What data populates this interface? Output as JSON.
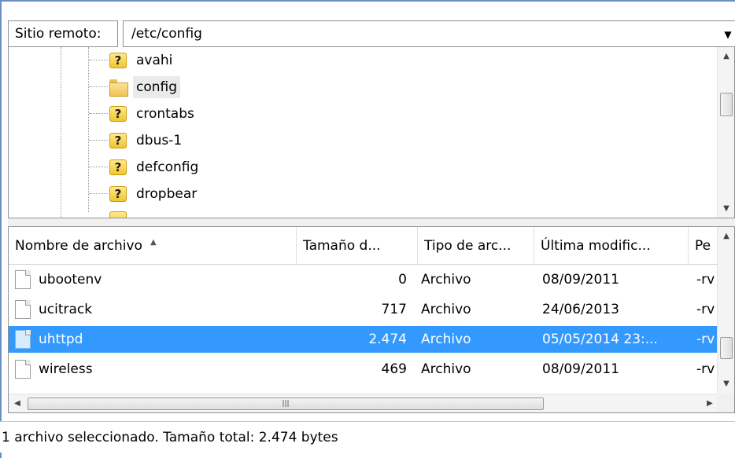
{
  "site_bar": {
    "label": "Sitio remoto:",
    "path": "/etc/config"
  },
  "tree": {
    "items": [
      {
        "label": "avahi",
        "icon": "unknown-folder-icon",
        "selected": false
      },
      {
        "label": "config",
        "icon": "folder-icon",
        "selected": true
      },
      {
        "label": "crontabs",
        "icon": "unknown-folder-icon",
        "selected": false
      },
      {
        "label": "dbus-1",
        "icon": "unknown-folder-icon",
        "selected": false
      },
      {
        "label": "defconfig",
        "icon": "unknown-folder-icon",
        "selected": false
      },
      {
        "label": "dropbear",
        "icon": "unknown-folder-icon",
        "selected": false
      }
    ]
  },
  "file_list": {
    "columns": [
      "Nombre de archivo",
      "Tamaño d...",
      "Tipo de arc...",
      "Última modific...",
      "Pe"
    ],
    "rows": [
      {
        "name": "ubootenv",
        "size": "0",
        "type": "Archivo",
        "modified": "08/09/2011",
        "perms": "-rv",
        "selected": false
      },
      {
        "name": "ucitrack",
        "size": "717",
        "type": "Archivo",
        "modified": "24/06/2013",
        "perms": "-rv",
        "selected": false
      },
      {
        "name": "uhttpd",
        "size": "2.474",
        "type": "Archivo",
        "modified": "05/05/2014 23:...",
        "perms": "-rv",
        "selected": true
      },
      {
        "name": "wireless",
        "size": "469",
        "type": "Archivo",
        "modified": "08/09/2011",
        "perms": "-rv",
        "selected": false
      }
    ]
  },
  "status": {
    "text": "1 archivo seleccionado. Tamaño total: 2.474 bytes"
  },
  "colors": {
    "selection": "#3399ff",
    "window_border": "#6a8fc7"
  }
}
